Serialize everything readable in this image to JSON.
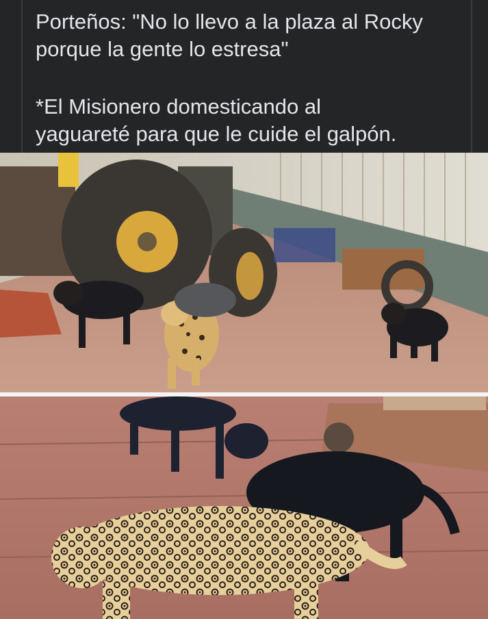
{
  "post": {
    "lines": [
      "Porteños: \"No lo llevo a la plaza al Rocky",
      "porque la gente lo estresa\"",
      "*El Misionero domesticando al",
      "yaguareté para que le cuide el galpón."
    ]
  },
  "images": {
    "top": "photo-jaguar-with-dogs-and-tractor",
    "bottom": "photo-jaguar-and-rottweiler-closeup"
  },
  "colors": {
    "background": "#242526",
    "text": "#e4e6eb",
    "divider": "#f4f4f4"
  }
}
